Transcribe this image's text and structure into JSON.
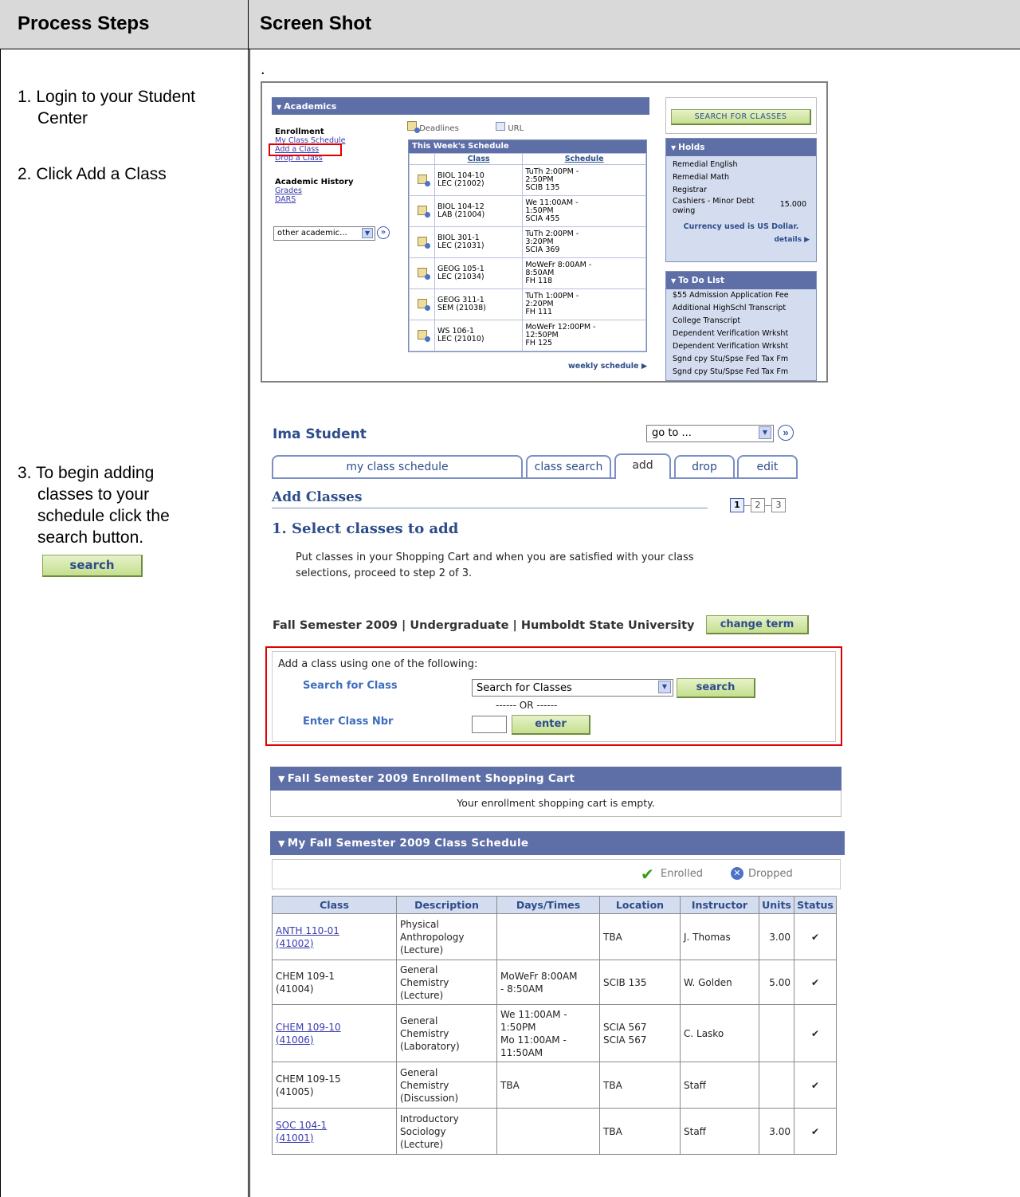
{
  "doc": {
    "col1_header": "Process Steps",
    "col2_header": "Screen Shot",
    "dot": ".",
    "step1_line1": "1. Login to your Student",
    "step1_line2": "Center",
    "step2": "2. Click Add a Class",
    "step3_line1": "3. To begin adding",
    "step3_line2": "classes to your",
    "step3_line3": "schedule click the",
    "step3_line4": "search button.",
    "step3_button": "search"
  },
  "academics": {
    "header": "Academics",
    "enrollment_label": "Enrollment",
    "links": [
      "My Class Schedule",
      "Add a Class",
      "Drop a Class"
    ],
    "history_label": "Academic History",
    "history_links": [
      "Grades",
      "DARS"
    ],
    "other_select": "other academic...",
    "deadlines": "Deadlines",
    "url": "URL",
    "week_title": "This Week's Schedule",
    "col_class": "Class",
    "col_schedule": "Schedule",
    "rows": [
      {
        "c1": "BIOL 104-10",
        "c2": "LEC (21002)",
        "s1": "TuTh 2:00PM -",
        "s2": "2:50PM",
        "s3": "SCIB 135"
      },
      {
        "c1": "BIOL 104-12",
        "c2": "LAB (21004)",
        "s1": "We 11:00AM -",
        "s2": "1:50PM",
        "s3": "SCIA 455"
      },
      {
        "c1": "BIOL 301-1",
        "c2": "LEC (21031)",
        "s1": "TuTh 2:00PM -",
        "s2": "3:20PM",
        "s3": "SCIA 369"
      },
      {
        "c1": "GEOG 105-1",
        "c2": "LEC (21034)",
        "s1": "MoWeFr 8:00AM -",
        "s2": "8:50AM",
        "s3": "FH 118"
      },
      {
        "c1": "GEOG 311-1",
        "c2": "SEM (21038)",
        "s1": "TuTh 1:00PM -",
        "s2": "2:20PM",
        "s3": "FH 111"
      },
      {
        "c1": "WS 106-1",
        "c2": "LEC (21010)",
        "s1": "MoWeFr 12:00PM -",
        "s2": "12:50PM",
        "s3": "FH 125"
      }
    ],
    "weekly_link": "weekly schedule",
    "search_btn": "SEARCH FOR CLASSES",
    "holds_title": "Holds",
    "holds": [
      "Remedial English",
      "Remedial Math",
      "Registrar",
      "Cashiers - Minor Debt",
      "owing"
    ],
    "holds_amount": "15.000",
    "currency": "Currency used is US Dollar.",
    "details": "details",
    "todo_title": "To Do List",
    "todo": [
      "$55 Admission Application Fee",
      "Additional HighSchl Transcript",
      "College Transcript",
      "Dependent Verification Wrksht",
      "Dependent Verification Wrksht",
      "Sgnd cpy Stu/Spse Fed Tax Fm",
      "Sgnd cpy Stu/Spse Fed Tax Fm"
    ]
  },
  "addclasses": {
    "student_name": "Ima Student",
    "goto": "go to ...",
    "tabs": [
      "my class schedule",
      "class search",
      "add",
      "drop",
      "edit"
    ],
    "page_title": "Add Classes",
    "step_nums": [
      "1",
      "2",
      "3"
    ],
    "section_title": "1.  Select classes to add",
    "instructions_l1": "Put classes in your Shopping Cart and when you are satisfied with your class",
    "instructions_l2": "selections, proceed to step 2 of 3.",
    "term_line": "Fall Semester 2009 | Undergraduate | Humboldt State University",
    "change_term": "change term",
    "add_intro": "Add a class using one of the following:",
    "search_for_class": "Search for Class",
    "search_select": "Search for Classes",
    "search_btn": "search",
    "or_text": "------ OR ------",
    "enter_class_nbr": "Enter Class Nbr",
    "enter_btn": "enter",
    "cart_title": "Fall Semester 2009 Enrollment Shopping Cart",
    "cart_empty": "Your enrollment shopping cart is empty.",
    "sched_title": "My Fall Semester 2009 Class Schedule",
    "legend_enrolled": "Enrolled",
    "legend_dropped": "Dropped",
    "headers": [
      "Class",
      "Description",
      "Days/Times",
      "Location",
      "Instructor",
      "Units",
      "Status"
    ],
    "rows": [
      {
        "class1": "ANTH 110-01",
        "class2": "(41002)",
        "link": true,
        "desc": [
          "Physical",
          "Anthropology",
          "(Lecture)"
        ],
        "days": [],
        "loc": [
          "TBA"
        ],
        "instr": "J. Thomas",
        "units": "3.00"
      },
      {
        "class1": "CHEM 109-1",
        "class2": "(41004)",
        "link": false,
        "desc": [
          "General",
          "Chemistry",
          "(Lecture)"
        ],
        "days": [
          "MoWeFr 8:00AM",
          "- 8:50AM"
        ],
        "loc": [
          "SCIB 135"
        ],
        "instr": "W. Golden",
        "units": "5.00"
      },
      {
        "class1": "CHEM 109-10",
        "class2": "(41006)",
        "link": true,
        "desc": [
          "General",
          "Chemistry",
          "(Laboratory)"
        ],
        "days": [
          "We 11:00AM -",
          "1:50PM",
          "Mo 11:00AM -",
          "11:50AM"
        ],
        "loc": [
          "SCIA 567",
          "SCIA 567"
        ],
        "instr": "C. Lasko",
        "units": ""
      },
      {
        "class1": "CHEM 109-15",
        "class2": "(41005)",
        "link": false,
        "desc": [
          "General",
          "Chemistry",
          "(Discussion)"
        ],
        "days": [
          "TBA"
        ],
        "loc": [
          "TBA"
        ],
        "instr": "Staff",
        "units": ""
      },
      {
        "class1": "SOC 104-1",
        "class2": "(41001)",
        "link": true,
        "desc": [
          "Introductory",
          "Sociology",
          "(Lecture)"
        ],
        "days": [],
        "loc": [
          "TBA"
        ],
        "instr": "Staff",
        "units": "3.00"
      }
    ]
  }
}
